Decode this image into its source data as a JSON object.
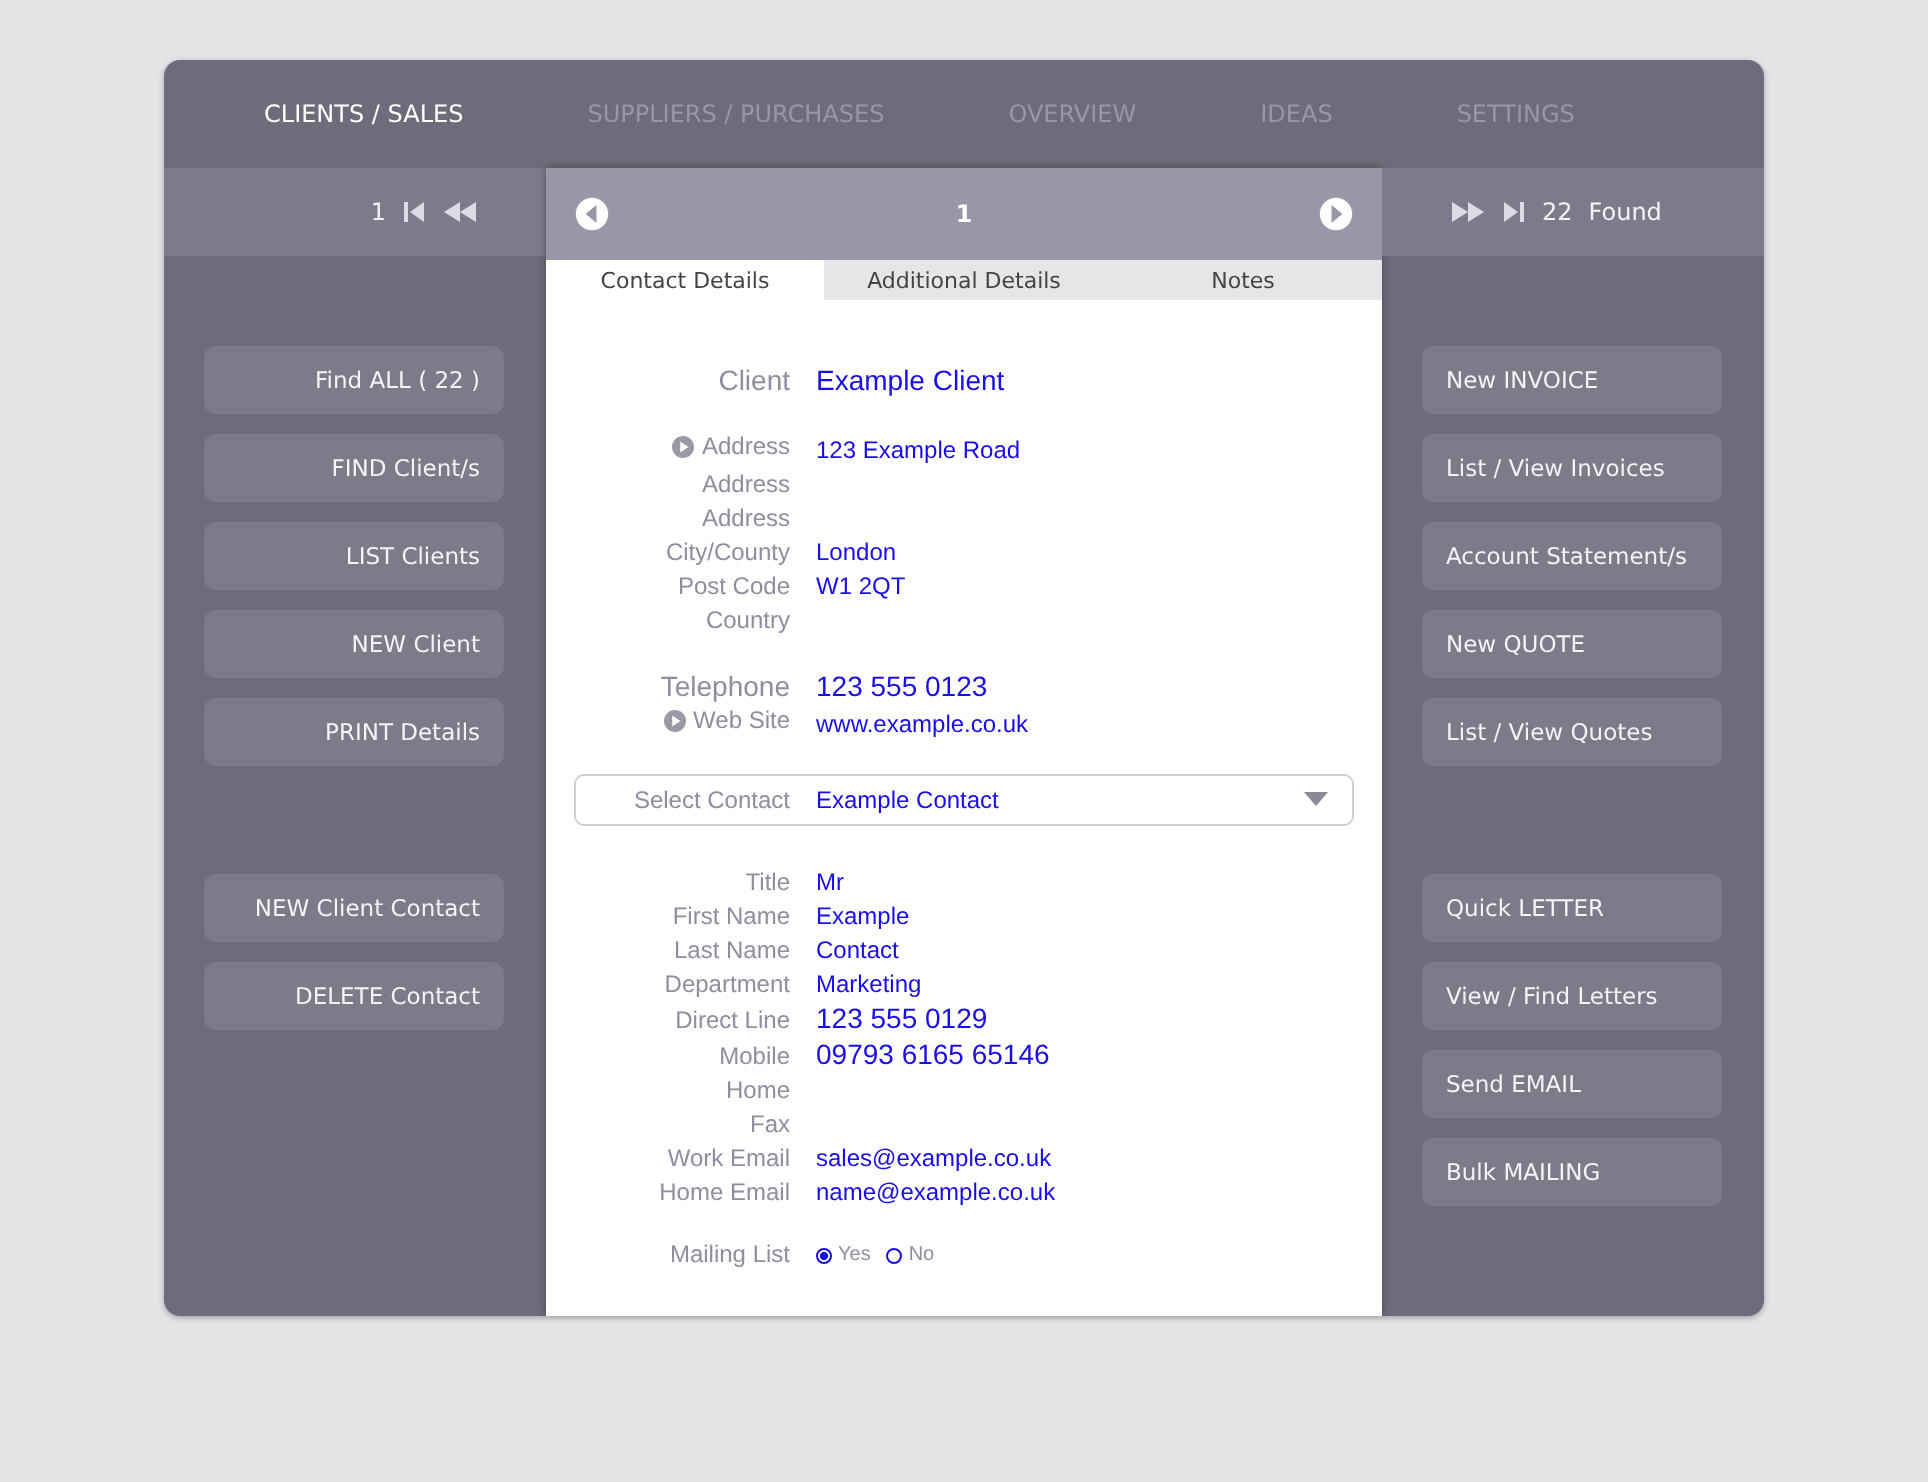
{
  "nav_tabs": [
    {
      "label": "CLIENTS / SALES",
      "selected": true
    },
    {
      "label": "SUPPLIERS / PURCHASES",
      "selected": false
    },
    {
      "label": "OVERVIEW",
      "selected": false
    },
    {
      "label": "IDEAS",
      "selected": false
    },
    {
      "label": "SETTINGS",
      "selected": false
    }
  ],
  "pager_left": {
    "record": "1"
  },
  "pager_right": {
    "count": "22",
    "found": "Found"
  },
  "record_header": {
    "record": "1"
  },
  "detail_tabs": [
    {
      "label": "Contact Details",
      "selected": true
    },
    {
      "label": "Additional Details",
      "selected": false
    },
    {
      "label": "Notes",
      "selected": false
    }
  ],
  "client_groups": [
    [
      {
        "label": "Client",
        "value": "Example Client",
        "large": true,
        "arrow": false
      }
    ],
    [
      {
        "label": "Address",
        "value": "123 Example Road",
        "large": false,
        "arrow": true
      },
      {
        "label": "Address",
        "large": false,
        "arrow": false
      },
      {
        "label": "Address",
        "large": false,
        "arrow": false
      },
      {
        "label": "City/County",
        "value": "London",
        "large": false,
        "arrow": false
      },
      {
        "label": "Post Code",
        "value": "W1 2QT",
        "large": false,
        "arrow": false
      },
      {
        "label": "Country",
        "large": false,
        "arrow": false
      }
    ],
    [
      {
        "label": "Telephone",
        "value": "123 555 0123",
        "large": true,
        "arrow": false
      },
      {
        "label": "Web Site",
        "value": "www.example.co.uk",
        "large": false,
        "arrow": true
      }
    ]
  ],
  "select_contact": {
    "label": "Select Contact",
    "value": "Example Contact"
  },
  "contact_fields": [
    {
      "label": "Title",
      "value": "Mr",
      "large": false
    },
    {
      "label": "First Name",
      "value": "Example",
      "large": false
    },
    {
      "label": "Last Name",
      "value": "Contact",
      "large": false
    },
    {
      "label": "Department",
      "value": "Marketing",
      "large": false
    },
    {
      "label": "Direct Line",
      "value": "123 555 0129",
      "large": true
    },
    {
      "label": "Mobile",
      "value": "09793 6165 65146",
      "large": true
    },
    {
      "label": "Home"
    },
    {
      "label": "Fax"
    },
    {
      "label": "Work Email",
      "value": "sales@example.co.uk",
      "large": false
    },
    {
      "label": "Home Email",
      "value": "name@example.co.uk",
      "large": false
    }
  ],
  "mailing_list": {
    "label": "Mailing List",
    "options": [
      {
        "label": "Yes",
        "selected": true
      },
      {
        "label": "No",
        "selected": false
      }
    ]
  },
  "left_buttons": [
    [
      "Find ALL  ( 22 )",
      "FIND Client/s",
      "LIST Clients",
      "NEW Client",
      "PRINT Details"
    ],
    [
      "NEW Client Contact",
      "DELETE Contact"
    ]
  ],
  "right_buttons": [
    [
      "New INVOICE",
      "List / View Invoices",
      "Account Statement/s",
      "New QUOTE",
      "List / View Quotes"
    ],
    [
      "Quick LETTER",
      "View / Find Letters",
      "Send EMAIL",
      "Bulk MAILING"
    ]
  ]
}
